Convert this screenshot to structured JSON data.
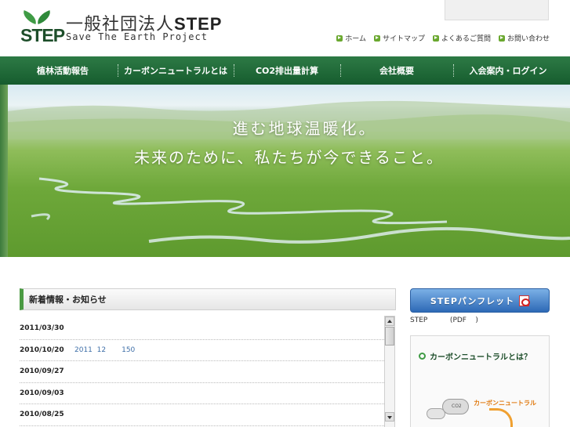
{
  "header": {
    "logo_text": "STEP",
    "org_name_prefix": "一般社団法人",
    "org_name_accent": "STEP",
    "tagline": "Save The Earth Project",
    "util_links": [
      {
        "label": "ホーム",
        "icon": "arrow-right-icon"
      },
      {
        "label": "サイトマップ",
        "icon": "arrow-right-icon"
      },
      {
        "label": "よくあるご質問",
        "icon": "arrow-right-icon"
      },
      {
        "label": "お問い合わせ",
        "icon": "arrow-right-icon"
      }
    ]
  },
  "nav": {
    "items": [
      {
        "label": "植林活動報告"
      },
      {
        "label": "カーボンニュートラルとは"
      },
      {
        "label": "CO2排出量計算"
      },
      {
        "label": "会社概要"
      },
      {
        "label": "入会案内・ログイン"
      }
    ]
  },
  "hero": {
    "line1": "進む地球温暖化。",
    "line2": "未来のために、私たちが今できること。"
  },
  "news": {
    "title": "新着情報・お知らせ",
    "items": [
      {
        "date": "2011/03/30",
        "text": ""
      },
      {
        "date": "2010/10/20",
        "text": "2011  12       150"
      },
      {
        "date": "2010/09/27",
        "text": ""
      },
      {
        "date": "2010/09/03",
        "text": ""
      },
      {
        "date": "2010/08/25",
        "text": ""
      }
    ]
  },
  "sidebar": {
    "pamphlet_label": "STEPパンフレット",
    "pamphlet_note": "STEP          (PDF    )",
    "carbon_title": "カーボンニュートラルとは？",
    "carbon_tag": "カーボンニュートラル",
    "cloud_label": "CO2"
  },
  "colors": {
    "brand_green": "#2d7a45",
    "accent_orange": "#e07a10",
    "link_blue": "#3f6fa8",
    "button_blue": "#2d69b6"
  }
}
